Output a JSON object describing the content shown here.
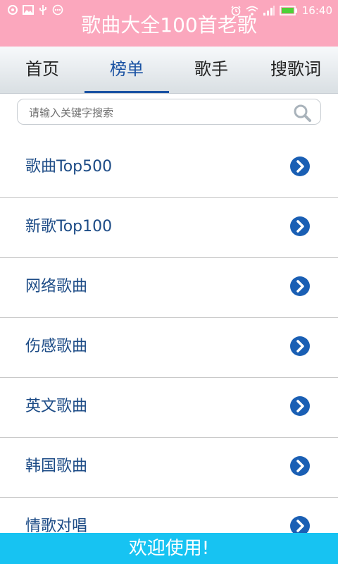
{
  "status_bar": {
    "time": "16:40",
    "left_icons": [
      "app-icon",
      "image-icon",
      "usb-icon",
      "more-icon"
    ],
    "right_icons": [
      "alarm-icon",
      "wifi-icon",
      "signal-icon",
      "battery-icon"
    ]
  },
  "app": {
    "title": "歌曲大全100首老歌"
  },
  "tabs": [
    {
      "label": "首页",
      "active": false
    },
    {
      "label": "榜单",
      "active": true
    },
    {
      "label": "歌手",
      "active": false
    },
    {
      "label": "搜歌词",
      "active": false
    }
  ],
  "search": {
    "placeholder": "请输入关键字搜索",
    "value": ""
  },
  "list": {
    "items": [
      {
        "label": "歌曲Top500"
      },
      {
        "label": "新歌Top100"
      },
      {
        "label": "网络歌曲"
      },
      {
        "label": "伤感歌曲"
      },
      {
        "label": "英文歌曲"
      },
      {
        "label": "韩国歌曲"
      },
      {
        "label": "情歌对唱"
      }
    ]
  },
  "banner": {
    "text": "欢迎使用!"
  },
  "colors": {
    "title_bar": "#fba7bd",
    "accent": "#1a52a3",
    "list_text": "#1c4b86",
    "banner": "#17c3f2"
  }
}
